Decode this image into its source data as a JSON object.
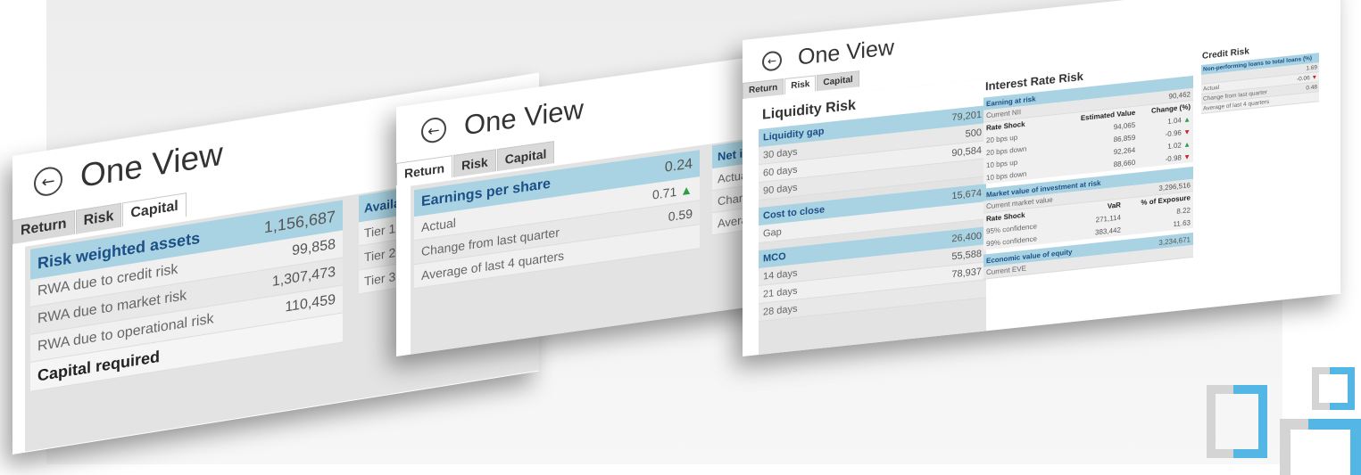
{
  "app_title": "One View",
  "tabs": [
    "Return",
    "Risk",
    "Capital"
  ],
  "colors": {
    "header_bg": "#a9d3e3",
    "header_text": "#1b4f86",
    "up": "#2e9d43",
    "down": "#c0262a",
    "deco_blue": "#54b6e5",
    "deco_gray": "#d4d4d4"
  },
  "icons": {
    "back": "back-arrow-circle-icon",
    "up": "triangle-up-icon",
    "down": "triangle-down-icon"
  },
  "capital_card": {
    "active_tab": "Capital",
    "rwa": {
      "header": "Risk weighted assets",
      "header_value": "1,156,687",
      "rows": [
        {
          "label": "RWA due to credit risk",
          "value": "99,858"
        },
        {
          "label": "RWA due to market risk",
          "value": "1,307,473"
        },
        {
          "label": "RWA due to operational risk",
          "value": "110,459"
        }
      ],
      "total_label": "Capital required"
    },
    "available": {
      "header": "Availa",
      "rows": [
        "Tier 1",
        "Tier 2",
        "Tier 3"
      ]
    }
  },
  "return_card": {
    "active_tab": "Return",
    "eps": {
      "header": "Earnings per share",
      "header_value": "0.24",
      "rows": [
        {
          "label": "Actual",
          "value": "0.71",
          "trend": "up"
        },
        {
          "label": "Change from last quarter",
          "value": "0.59"
        },
        {
          "label": "Average of last 4 quarters",
          "value": ""
        }
      ]
    },
    "net_income": {
      "header": "Net in",
      "rows": [
        "Actual",
        "Chang",
        "Averag"
      ]
    }
  },
  "risk_card": {
    "active_tab": "Risk",
    "liquidity": {
      "title": "Liquidity Risk",
      "gap": {
        "header": "Liquidity gap",
        "header_value": "79,201",
        "rows": [
          {
            "label": "30 days",
            "value": "500"
          },
          {
            "label": "60 days",
            "value": "90,584"
          },
          {
            "label": "90 days",
            "value": ""
          }
        ]
      },
      "cost": {
        "header": "Cost to close",
        "header_value": "15,674",
        "rows": [
          {
            "label": "Gap",
            "value": ""
          }
        ]
      },
      "mco": {
        "header": "MCO",
        "header_value": "26,400",
        "rows": [
          {
            "label": "14 days",
            "value": "55,588"
          },
          {
            "label": "21 days",
            "value": "78,937"
          },
          {
            "label": "28 days",
            "value": ""
          }
        ]
      }
    },
    "interest": {
      "title": "Interest Rate Risk",
      "ear": {
        "header": "Earning at risk",
        "header_value": "90,462",
        "current_label": "Current NII",
        "columns": [
          "Rate Shock",
          "Estimated Value",
          "Change (%)"
        ],
        "rows": [
          {
            "label": "20 bps up",
            "value": "94,065",
            "change": "1.04",
            "trend": "up"
          },
          {
            "label": "20 bps down",
            "value": "86,859",
            "change": "-0.96",
            "trend": "down"
          },
          {
            "label": "10 bps up",
            "value": "92,264",
            "change": "1.02",
            "trend": "up"
          },
          {
            "label": "10 bps down",
            "value": "88,660",
            "change": "-0.98",
            "trend": "down"
          }
        ]
      },
      "mvir": {
        "header": "Market value of investment at risk",
        "header_value": "3,296,516",
        "current_label": "Current market value",
        "columns": [
          "Rate Shock",
          "VaR",
          "% of Exposure"
        ],
        "rows": [
          {
            "label": "95% confidence",
            "var": "271,114",
            "pct": "8.22"
          },
          {
            "label": "99% confidence",
            "var": "383,442",
            "pct": "11.63"
          }
        ]
      },
      "eve": {
        "header": "Economic value of equity",
        "header_value": "3,234,671",
        "current_label": "Current EVE"
      }
    },
    "credit": {
      "title": "Credit Risk",
      "npl": {
        "header": "Non-performing loans to total loans (%)",
        "header_value": "1.69",
        "rows": [
          {
            "label": "Actual",
            "value": "-0.06",
            "trend": "down"
          },
          {
            "label": "Change from last quarter",
            "value": "0.48"
          },
          {
            "label": "Average of last 4 quarters",
            "value": ""
          }
        ]
      }
    }
  }
}
